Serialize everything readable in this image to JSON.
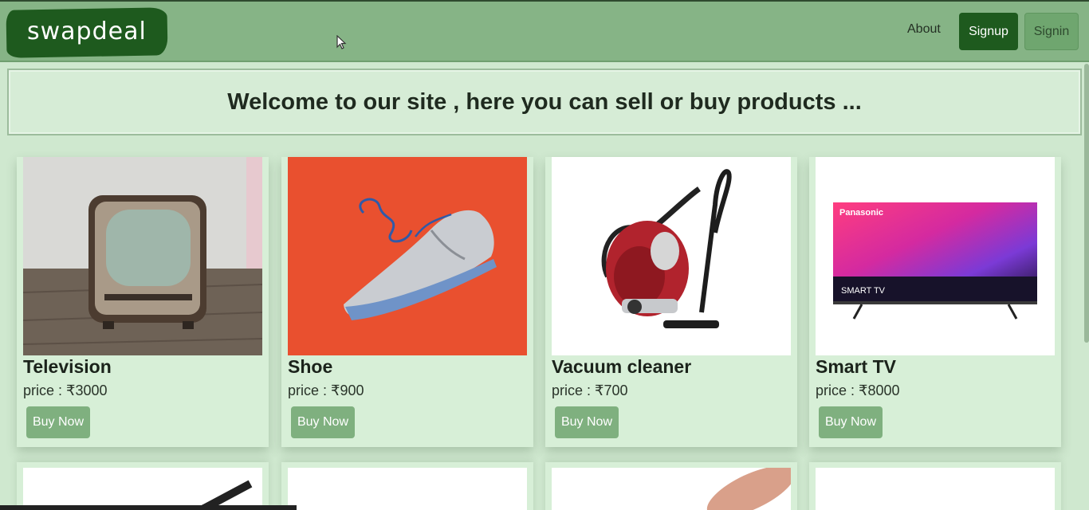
{
  "header": {
    "logo_text": "swapdeal",
    "nav": {
      "about": "About",
      "signup": "Signup",
      "signin": "Signin"
    }
  },
  "welcome": {
    "text": "Welcome to our site , here you can sell or buy products ..."
  },
  "products": [
    {
      "name": "Television",
      "price": "price : ₹3000",
      "button": "Buy Now"
    },
    {
      "name": "Shoe",
      "price": "price : ₹900",
      "button": "Buy Now"
    },
    {
      "name": "Vacuum cleaner",
      "price": "price : ₹700",
      "button": "Buy Now"
    },
    {
      "name": "Smart TV",
      "price": "price : ₹8000",
      "button": "Buy Now"
    }
  ],
  "tv_brand": "Panasonic",
  "tv_screen_text": "SMART TV",
  "colors": {
    "nav_bg": "#86b486",
    "brand": "#1e5a1e",
    "page_bg": "#cfe8cf",
    "buy_button": "#7fb07f"
  }
}
